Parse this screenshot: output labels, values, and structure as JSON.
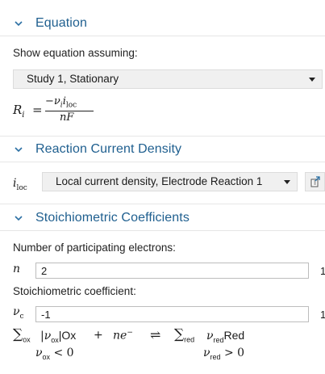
{
  "equation_section": {
    "title": "Equation",
    "show_label": "Show equation assuming:",
    "study_value": "Study 1, Stationary",
    "lhs": "R",
    "lhs_sub": "i",
    "equals": "=",
    "num_prefix": "−ν",
    "num_sub_i": "i",
    "num_i": "i",
    "num_loc": "loc",
    "den": "nF"
  },
  "current_section": {
    "title": "Reaction Current Density",
    "symbol": "i",
    "symbol_sub": "loc",
    "dropdown_value": "Local current density, Electrode Reaction 1"
  },
  "stoich_section": {
    "title": "Stoichiometric Coefficients",
    "electrons_label": "Number of participating electrons:",
    "n_symbol": "n",
    "n_value": "2",
    "n_unit": "1",
    "coeff_label": "Stoichiometric coefficient:",
    "nu_symbol": "ν",
    "nu_sub": "c",
    "nu_value": "-1",
    "nu_unit": "1",
    "eq_sum1": "∑",
    "eq_sum1_sub": "ox",
    "eq_abs": "|ν",
    "eq_abs_sub": "ox",
    "eq_ox": "|Ox",
    "eq_plus": "+",
    "eq_ne": "ne",
    "eq_ne_sup": "−",
    "eq_arrow": "⇌",
    "eq_sum2": "∑",
    "eq_sum2_sub": "red",
    "eq_nu2": "ν",
    "eq_nu2_sub": "red",
    "eq_red": "Red",
    "cond1": "ν",
    "cond1_sub": "ox",
    "cond1_rest": " < 0",
    "cond2": "ν",
    "cond2_sub": "red",
    "cond2_rest": " > 0"
  }
}
